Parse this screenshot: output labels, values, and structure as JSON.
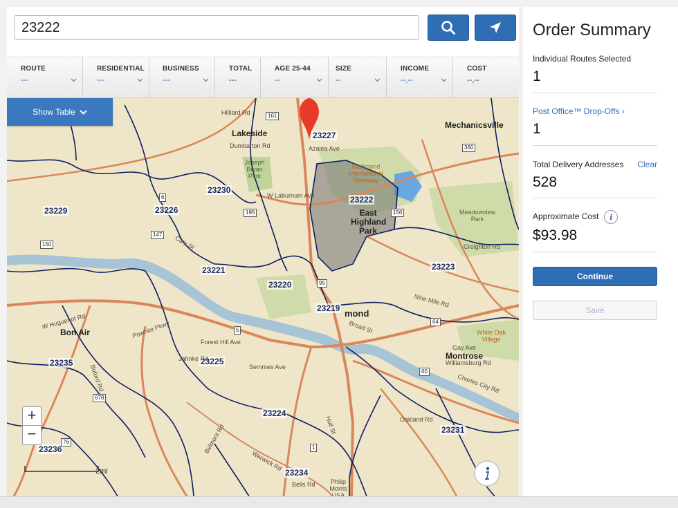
{
  "search": {
    "value": "23222",
    "placeholder": ""
  },
  "icons": {
    "search": "search-icon",
    "locate": "location-arrow-icon",
    "chevron": "chevron-down-icon",
    "info": "info-icon",
    "pin": "map-pin-icon"
  },
  "filters": [
    {
      "label": "ROUTE",
      "value": "---",
      "name": "route"
    },
    {
      "label": "RESIDENTIAL",
      "value": "---",
      "name": "residential"
    },
    {
      "label": "BUSINESS",
      "value": "---",
      "name": "business"
    },
    {
      "label": "TOTAL",
      "value": "---",
      "name": "total"
    },
    {
      "label": "AGE 25-44",
      "value": "--",
      "name": "age"
    },
    {
      "label": "SIZE",
      "value": "--",
      "name": "size"
    },
    {
      "label": "INCOME",
      "value": "--,--",
      "name": "income"
    },
    {
      "label": "COST",
      "value": "--,--",
      "name": "cost"
    }
  ],
  "map": {
    "show_table": "Show Table",
    "zoom_in": "+",
    "zoom_out": "−",
    "scale_label": "2mi",
    "zip_labels": [
      "23227",
      "23230",
      "23229",
      "23226",
      "23222",
      "23221",
      "23220",
      "23219",
      "23223",
      "23225",
      "23235",
      "23224",
      "23231",
      "23236",
      "23234"
    ],
    "places": [
      "Lakeside",
      "Mechanicsville",
      "Bon Air",
      "Montrose",
      "East Highland Park",
      "Richmond International Raceway",
      "Joseph Bryan Park",
      "Meadowview Park",
      "White Oak Village",
      "Dumbarton Rd",
      "Azalea Ave",
      "W Laburnum Ave",
      "Hilliard Rd",
      "Forest Hill Ave",
      "Jahnke Rd",
      "Powhite Pkwy",
      "W Huguenot Rd",
      "Buford Rd",
      "Williamsburg Rd",
      "Charles City Rd",
      "Oakland Rd",
      "Creighton Rd",
      "Nine Mile Rd",
      "Semmes Ave",
      "Broad St",
      "Gay Ave",
      "Cary St",
      "Hull St",
      "Belmont Rd",
      "Warwick Rd",
      "Bells Rd",
      "Philip Morris USA"
    ],
    "road_shields": [
      "161",
      "64",
      "360",
      "195",
      "6",
      "147",
      "150",
      "156",
      "60",
      "76",
      "678",
      "5",
      "1",
      "95"
    ],
    "fragment_text": "mond",
    "colors": {
      "land": "#efe6c9",
      "boundary": "#0d1f63",
      "highway": "#d9875a",
      "water": "#a7c4d6",
      "park": "#bfd39a",
      "selected": "#7b7b7b",
      "accent": "#2f6db5",
      "pin": "#e83a2b"
    }
  },
  "summary": {
    "title": "Order Summary",
    "routes_label": "Individual Routes Selected",
    "routes_value": "1",
    "dropoffs_label": "Post Office™ Drop-Offs ›",
    "dropoffs_value": "1",
    "addresses_label": "Total Delivery Addresses",
    "clear_label": "Clear",
    "addresses_value": "528",
    "cost_label": "Approximate Cost",
    "cost_value": "$93.98",
    "continue_label": "Continue",
    "save_label": "Save"
  }
}
